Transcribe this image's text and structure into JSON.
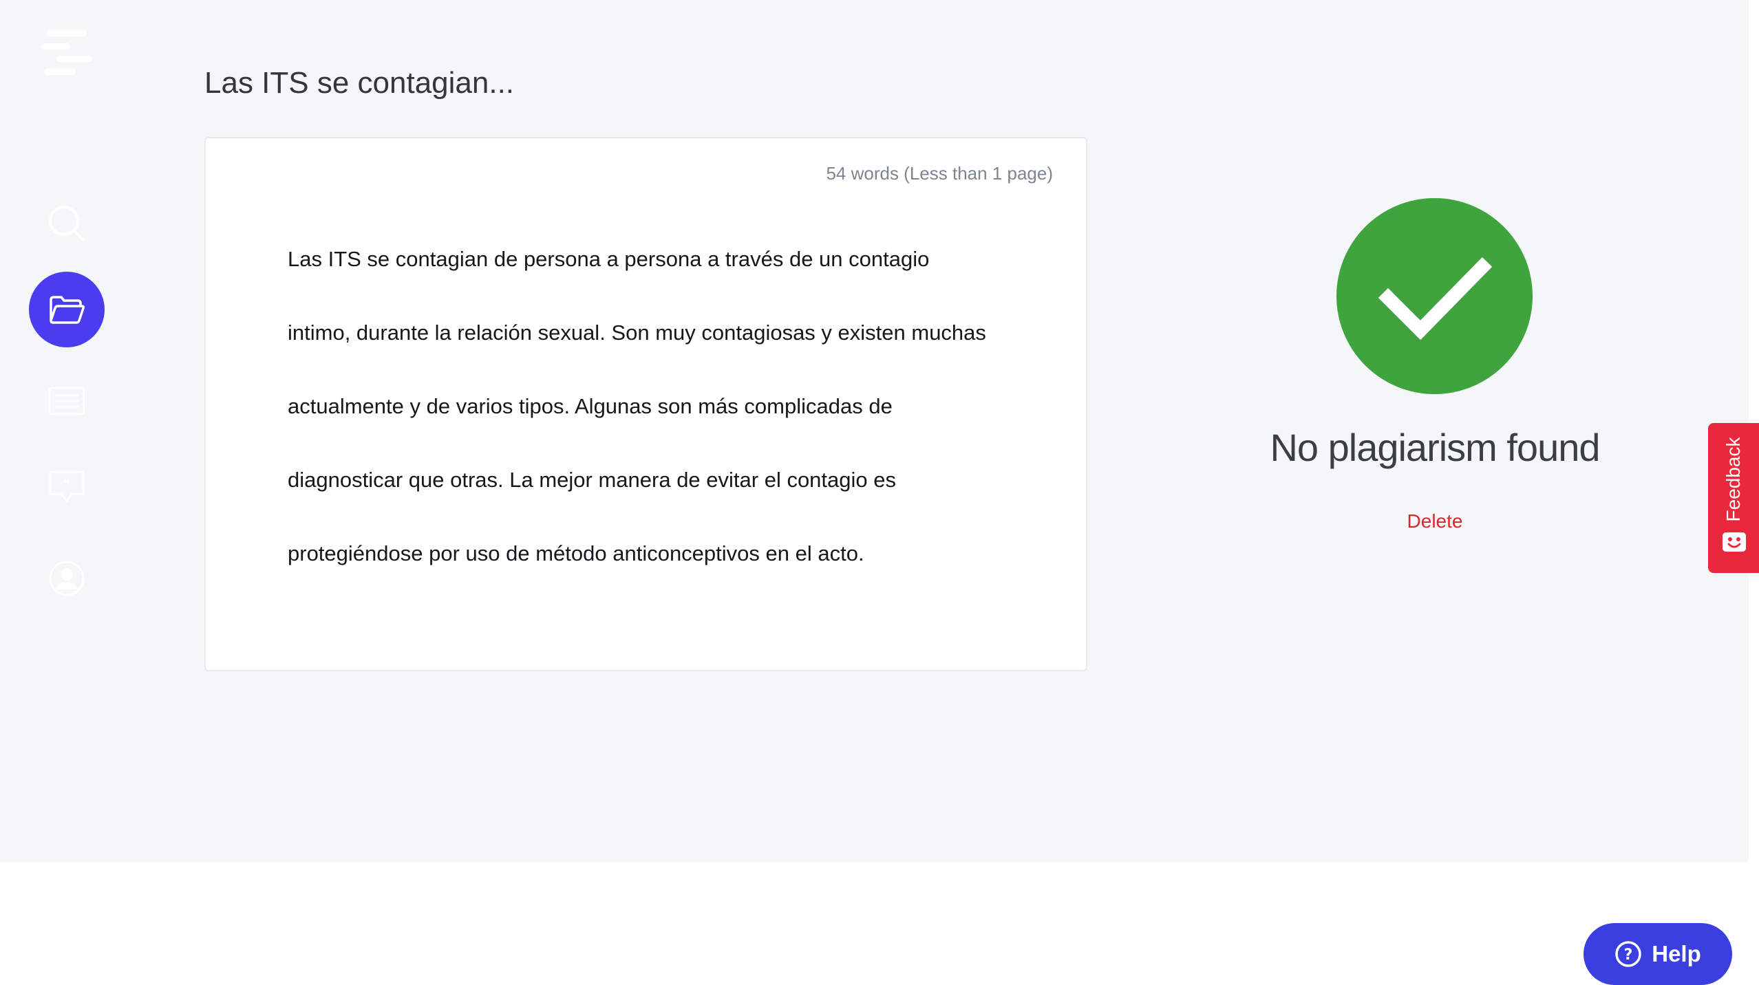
{
  "document": {
    "title": "Las ITS se contagian...",
    "word_count": "54 words (Less than 1 page)",
    "lines": [
      "Las ITS se contagian de persona a persona a través de un contagio",
      "intimo, durante la relación sexual. Son muy contagiosas y existen muchas",
      "actualmente y de varios tipos. Algunas son más complicadas de",
      "diagnosticar que otras. La mejor manera de evitar el contagio es",
      "protegiéndose por uso de método anticonceptivos en el acto."
    ]
  },
  "sidebar": {
    "items": [
      {
        "name": "search",
        "icon": "search-icon",
        "active": false
      },
      {
        "name": "documents",
        "icon": "folder-icon",
        "active": true
      },
      {
        "name": "list",
        "icon": "list-icon",
        "active": false
      },
      {
        "name": "quotes",
        "icon": "quote-bubble-icon",
        "active": false
      },
      {
        "name": "account",
        "icon": "user-icon",
        "active": false
      }
    ]
  },
  "result": {
    "status": "No plagiarism found",
    "delete_label": "Delete",
    "icon": "checkmark-icon"
  },
  "feedback": {
    "label": "Feedback"
  },
  "help": {
    "label": "Help"
  },
  "colors": {
    "accent": "#4a3df0",
    "success": "#3fa43e",
    "danger": "#d9272e",
    "feedback": "#e8293c",
    "help": "#3b3fe0",
    "background": "#f5f6f8"
  }
}
